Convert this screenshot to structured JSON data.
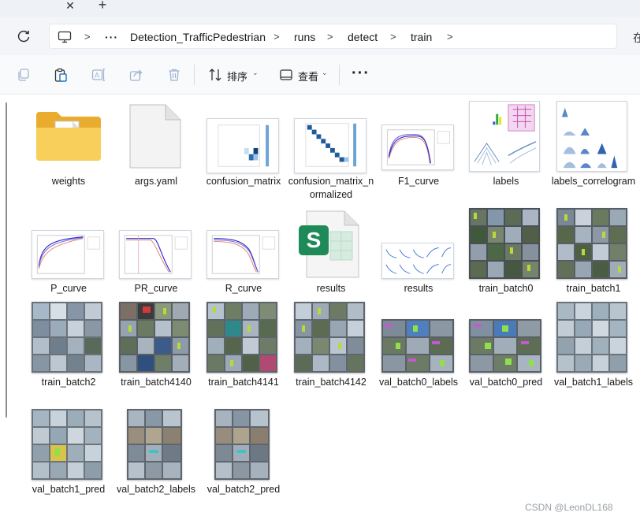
{
  "tabstrip": {
    "close_glyph": "✕",
    "new_glyph": "+"
  },
  "address": {
    "breadcrumbs": [
      "Detection_TrafficPedestrian",
      "runs",
      "detect",
      "train"
    ],
    "overflow": "···",
    "right_edge": "在"
  },
  "commands": {
    "sort_label": "排序",
    "view_label": "查看",
    "more_label": "···",
    "icons": [
      "copy-icon",
      "paste-icon",
      "rename-icon",
      "share-icon",
      "delete-icon"
    ]
  },
  "files": [
    {
      "name": "weights",
      "type": "folder"
    },
    {
      "name": "args.yaml",
      "type": "file"
    },
    {
      "name": "confusion_matrix",
      "type": "plot"
    },
    {
      "name": "confusion_matrix_normalized",
      "type": "plot"
    },
    {
      "name": "F1_curve",
      "type": "plot"
    },
    {
      "name": "labels",
      "type": "plot"
    },
    {
      "name": "labels_correlogram",
      "type": "plot"
    },
    {
      "name": "P_curve",
      "type": "plot"
    },
    {
      "name": "PR_curve",
      "type": "plot"
    },
    {
      "name": "R_curve",
      "type": "plot"
    },
    {
      "name": "results",
      "type": "spreadsheet"
    },
    {
      "name": "results",
      "type": "plot"
    },
    {
      "name": "train_batch0",
      "type": "photo"
    },
    {
      "name": "train_batch1",
      "type": "photo"
    },
    {
      "name": "train_batch2",
      "type": "photo"
    },
    {
      "name": "train_batch4140",
      "type": "photo"
    },
    {
      "name": "train_batch4141",
      "type": "photo"
    },
    {
      "name": "train_batch4142",
      "type": "photo"
    },
    {
      "name": "val_batch0_labels",
      "type": "photo"
    },
    {
      "name": "val_batch0_pred",
      "type": "photo"
    },
    {
      "name": "val_batch1_labels",
      "type": "photo"
    },
    {
      "name": "val_batch1_pred",
      "type": "photo"
    },
    {
      "name": "val_batch2_labels",
      "type": "photo"
    },
    {
      "name": "val_batch2_pred",
      "type": "photo"
    }
  ],
  "watermark": "CSDN @LeonDL168",
  "colors": {
    "folder": "#f4c247",
    "spreadsheet": "#1e8a57",
    "accent": "#0067c0"
  }
}
